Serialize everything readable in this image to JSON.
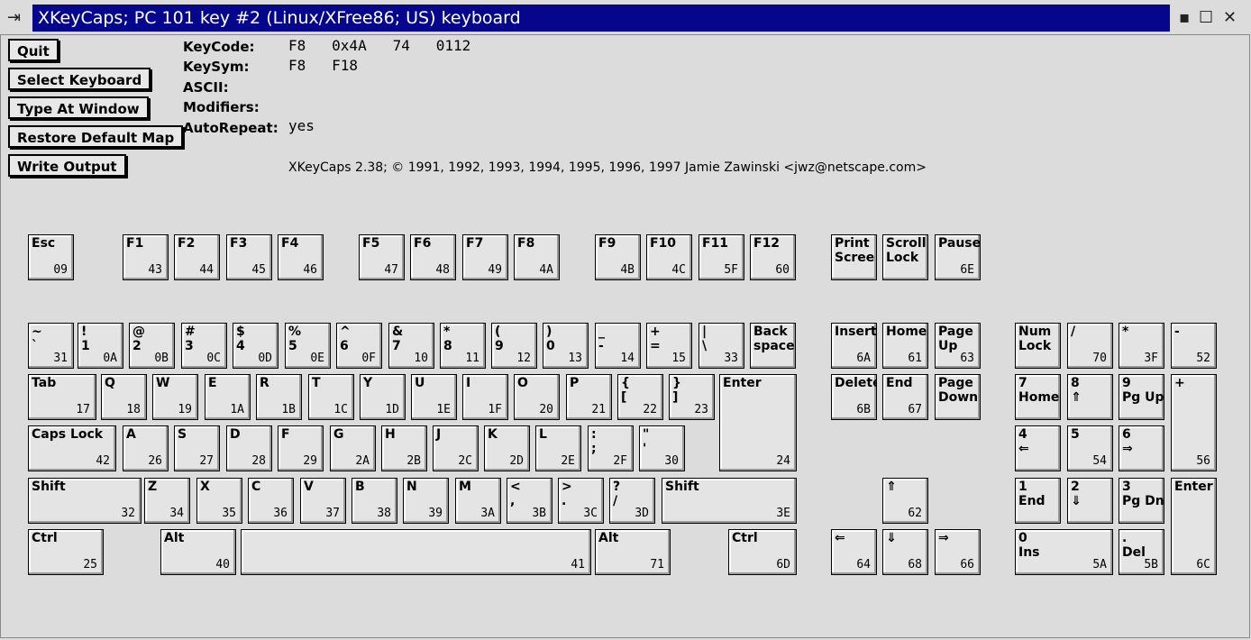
{
  "window": {
    "title": "XKeyCaps; PC 101 key #2 (Linux/XFree86; US) keyboard",
    "menu_glyph": "⇥",
    "controls": {
      "minimize": "▪",
      "maximize": "☐",
      "close": "✕"
    }
  },
  "buttons": {
    "quit": "Quit",
    "select_keyboard": "Select Keyboard",
    "type_at_window": "Type At Window",
    "restore_default_map": "Restore Default Map",
    "write_output": "Write Output"
  },
  "info": {
    "keycode_label": "KeyCode:",
    "keycode_value": "F8   0x4A   74   0112",
    "keysym_label": "KeySym:",
    "keysym_value": "F8   F18",
    "ascii_label": "ASCII:",
    "ascii_value": "",
    "modifiers_label": "Modifiers:",
    "modifiers_value": "",
    "autorepeat_label": "AutoRepeat:",
    "autorepeat_value": "yes"
  },
  "copyright": "XKeyCaps 2.38; © 1991, 1992, 1993, 1994, 1995, 1996, 1997 Jamie Zawinski <jwz@netscape.com>",
  "keys": [
    {
      "label": "Esc",
      "code": "09"
    },
    {
      "label": "F1",
      "code": "43"
    },
    {
      "label": "F2",
      "code": "44"
    },
    {
      "label": "F3",
      "code": "45"
    },
    {
      "label": "F4",
      "code": "46"
    },
    {
      "label": "F5",
      "code": "47"
    },
    {
      "label": "F6",
      "code": "48"
    },
    {
      "label": "F7",
      "code": "49"
    },
    {
      "label": "F8",
      "code": "4A"
    },
    {
      "label": "F9",
      "code": "4B"
    },
    {
      "label": "F10",
      "code": "4C"
    },
    {
      "label": "F11",
      "code": "5F"
    },
    {
      "label": "F12",
      "code": "60"
    },
    {
      "label": "Print\nScree",
      "code": ""
    },
    {
      "label": "Scroll\nLock",
      "code": ""
    },
    {
      "label": "Pause",
      "code": "6E"
    },
    {
      "label": "~\n`",
      "code": "31"
    },
    {
      "label": "!\n1",
      "code": "0A"
    },
    {
      "label": "@\n2",
      "code": "0B"
    },
    {
      "label": "#\n3",
      "code": "0C"
    },
    {
      "label": "$\n4",
      "code": "0D"
    },
    {
      "label": "%\n5",
      "code": "0E"
    },
    {
      "label": "^\n6",
      "code": "0F"
    },
    {
      "label": "&\n7",
      "code": "10"
    },
    {
      "label": "*\n8",
      "code": "11"
    },
    {
      "label": "(\n9",
      "code": "12"
    },
    {
      "label": ")\n0",
      "code": "13"
    },
    {
      "label": "_\n-",
      "code": "14"
    },
    {
      "label": "+\n=",
      "code": "15"
    },
    {
      "label": "|\n\\",
      "code": "33"
    },
    {
      "label": "Back\nspace",
      "code": ""
    },
    {
      "label": "Insert",
      "code": "6A"
    },
    {
      "label": "Home",
      "code": "61"
    },
    {
      "label": "Page\nUp",
      "code": "63"
    },
    {
      "label": "Num\nLock",
      "code": ""
    },
    {
      "label": "/",
      "code": "70"
    },
    {
      "label": "*",
      "code": "3F"
    },
    {
      "label": "-",
      "code": "52"
    },
    {
      "label": "Tab",
      "code": "17"
    },
    {
      "label": "Q",
      "code": "18"
    },
    {
      "label": "W",
      "code": "19"
    },
    {
      "label": "E",
      "code": "1A"
    },
    {
      "label": "R",
      "code": "1B"
    },
    {
      "label": "T",
      "code": "1C"
    },
    {
      "label": "Y",
      "code": "1D"
    },
    {
      "label": "U",
      "code": "1E"
    },
    {
      "label": "I",
      "code": "1F"
    },
    {
      "label": "O",
      "code": "20"
    },
    {
      "label": "P",
      "code": "21"
    },
    {
      "label": "{\n[",
      "code": "22"
    },
    {
      "label": "}\n]",
      "code": "23"
    },
    {
      "label": "Enter",
      "code": "24"
    },
    {
      "label": "Delete",
      "code": "6B"
    },
    {
      "label": "End",
      "code": "67"
    },
    {
      "label": "Page\nDown",
      "code": ""
    },
    {
      "label": "7\nHome",
      "code": ""
    },
    {
      "label": "8\n⇑",
      "code": ""
    },
    {
      "label": "9\nPg Up",
      "code": ""
    },
    {
      "label": "+",
      "code": "56"
    },
    {
      "label": "Caps Lock",
      "code": "42"
    },
    {
      "label": "A",
      "code": "26"
    },
    {
      "label": "S",
      "code": "27"
    },
    {
      "label": "D",
      "code": "28"
    },
    {
      "label": "F",
      "code": "29"
    },
    {
      "label": "G",
      "code": "2A"
    },
    {
      "label": "H",
      "code": "2B"
    },
    {
      "label": "J",
      "code": "2C"
    },
    {
      "label": "K",
      "code": "2D"
    },
    {
      "label": "L",
      "code": "2E"
    },
    {
      "label": ":\n;",
      "code": "2F"
    },
    {
      "label": "\"\n'",
      "code": "30"
    },
    {
      "label": "4\n⇐",
      "code": ""
    },
    {
      "label": "5",
      "code": "54"
    },
    {
      "label": "6\n⇒",
      "code": ""
    },
    {
      "label": "Shift",
      "code": "32"
    },
    {
      "label": "Z",
      "code": "34"
    },
    {
      "label": "X",
      "code": "35"
    },
    {
      "label": "C",
      "code": "36"
    },
    {
      "label": "V",
      "code": "37"
    },
    {
      "label": "B",
      "code": "38"
    },
    {
      "label": "N",
      "code": "39"
    },
    {
      "label": "M",
      "code": "3A"
    },
    {
      "label": "<\n,",
      "code": "3B"
    },
    {
      "label": ">\n.",
      "code": "3C"
    },
    {
      "label": "?\n/",
      "code": "3D"
    },
    {
      "label": "Shift",
      "code": "3E"
    },
    {
      "label": "⇑",
      "code": "62"
    },
    {
      "label": "1\nEnd",
      "code": ""
    },
    {
      "label": "2\n⇓",
      "code": ""
    },
    {
      "label": "3\nPg Dn",
      "code": ""
    },
    {
      "label": "Enter",
      "code": "6C"
    },
    {
      "label": "Ctrl",
      "code": "25"
    },
    {
      "label": "Alt",
      "code": "40"
    },
    {
      "label": "",
      "code": "41"
    },
    {
      "label": "Alt",
      "code": "71"
    },
    {
      "label": "Ctrl",
      "code": "6D"
    },
    {
      "label": "⇐",
      "code": "64"
    },
    {
      "label": "⇓",
      "code": "68"
    },
    {
      "label": "⇒",
      "code": "66"
    },
    {
      "label": "0\nIns",
      "code": "5A"
    },
    {
      "label": ".\nDel",
      "code": "5B"
    }
  ]
}
